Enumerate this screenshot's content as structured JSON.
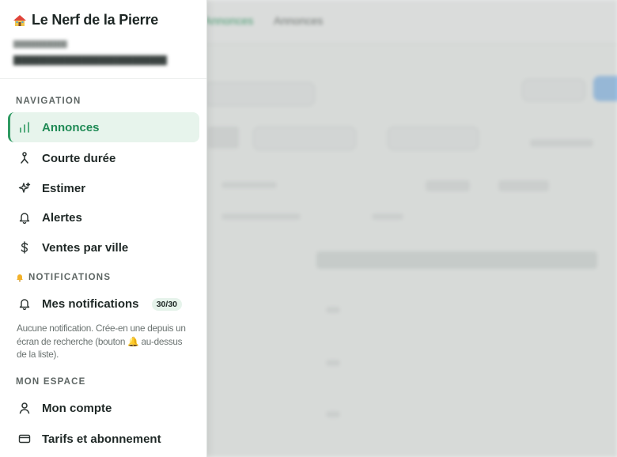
{
  "app": {
    "brand_icon": "house-icon",
    "brand_name": "Le Nerf de la Pierre"
  },
  "background": {
    "tabs": [
      "Annonces",
      "Annonces"
    ]
  },
  "sections": {
    "navigation": "NAVIGATION",
    "notifications": "NOTIFICATIONS",
    "my_space": "MON ESPACE"
  },
  "nav": {
    "items": [
      {
        "label": "Annonces",
        "icon": "bar-chart-icon",
        "active": true
      },
      {
        "label": "Courte durée",
        "icon": "person-walking-icon"
      },
      {
        "label": "Estimer",
        "icon": "sparkles-icon"
      },
      {
        "label": "Alertes",
        "icon": "bell-icon"
      },
      {
        "label": "Ventes par ville",
        "icon": "dollar-icon"
      }
    ]
  },
  "notifications": {
    "item_label": "Mes notifications",
    "item_icon": "bell-icon",
    "count_badge": "30/30",
    "help_text": "Aucune notification. Crée-en une depuis un écran de recherche (bouton 🔔 au-dessus de la liste)."
  },
  "my_space": {
    "items": [
      {
        "label": "Mon compte",
        "icon": "user-icon"
      },
      {
        "label": "Tarifs et abonnement",
        "icon": "credit-card-icon"
      }
    ]
  },
  "colors": {
    "accent_green": "#2f9a62",
    "active_bg": "#e7f4ec",
    "bell": "#f2b12a"
  }
}
